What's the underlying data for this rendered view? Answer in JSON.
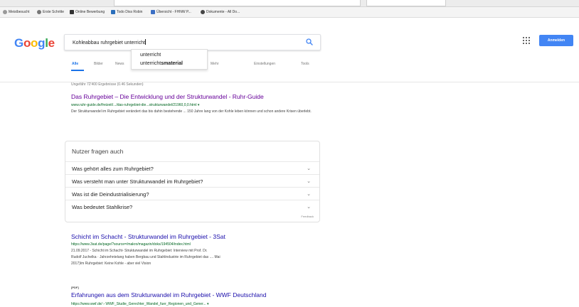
{
  "bookmarks": [
    {
      "label": "Meistbesucht",
      "color": "#999999"
    },
    {
      "label": "Erste Schritte",
      "color": "#777777"
    },
    {
      "label": "Online Bewerbung",
      "color": "#333333"
    },
    {
      "label": "Todo Diss Robin",
      "color": "#2a6ebb"
    },
    {
      "label": "Übersicht - FHNW P...",
      "color": "#3b6fc4"
    },
    {
      "label": "Dokumente - All Do...",
      "color": "#444444"
    }
  ],
  "search": {
    "query": "Kohleabbau ruhrgebiet unterricht",
    "suggestions": [
      {
        "text": "unterricht",
        "bold": ""
      },
      {
        "text": "unterricht",
        "bold": "smaterial"
      }
    ]
  },
  "tabs": [
    "Alle",
    "Bilder",
    "News",
    "Mehr",
    "Einstellungen",
    "Tools"
  ],
  "signin_label": "Anmelden",
  "stats": "Ungefähr 72'400 Ergebnisse (0.46 Sekunden)",
  "results": [
    {
      "title": "Das Ruhrgebiet – Die Entwicklung und der Strukturwandel - Ruhr-Guide",
      "url": "www.ruhr-guide.de/freizeit/.../das-ruhrgebiet-die...strukturwandel/21960,0,0.html ▾",
      "snippet": "Der Strukturwandel im Ruhrgebiet verändert das bis dahin bestehende ... 150 Jahre lang von der Kohle leben können und schon andere Krisen überlebt."
    },
    {
      "title": "Schicht im Schacht - Strukturwandel im Ruhrgebiet - 3Sat",
      "url": "https://www.3sat.de/page/?source=/makro/magazin/doks/194504/index.html",
      "snippet_lines": [
        "21.09.2017 - Schicht im Schacht- Strukturwandel im Ruhrgebiet: Interview mit Prof. Dr.",
        "Rudolf Juchelka · Jahrzehntelang haben Bergbau und Stahlindustrie im Ruhrgebiet das .... Mai",
        "2017)Im Ruhrgebiet: Keine Kohle - aber viel Vision"
      ]
    },
    {
      "tag": "[PDF]",
      "title": "Erfahrungen aus dem Strukturwandel im Ruhrgebiet - WWF Deutschland",
      "url": "https://www.wwf.de/ › WWF_Studie_Gerechter_Wandel_fuer_Regionen_und_Gener... ▾"
    }
  ],
  "paa": {
    "heading": "Nutzer fragen auch",
    "questions": [
      "Was gehört alles zum Ruhrgebiet?",
      "Was versteht man unter Strukturwandel im Ruhrgebiet?",
      "Was ist die Deindustrialisierung?",
      "Was bedeutet Stahlkrise?"
    ],
    "feedback": "Feedback"
  },
  "colors": {
    "link_visited": "#660099",
    "link": "#1a0dab",
    "url_green": "#006621",
    "accent": "#4285f4"
  }
}
